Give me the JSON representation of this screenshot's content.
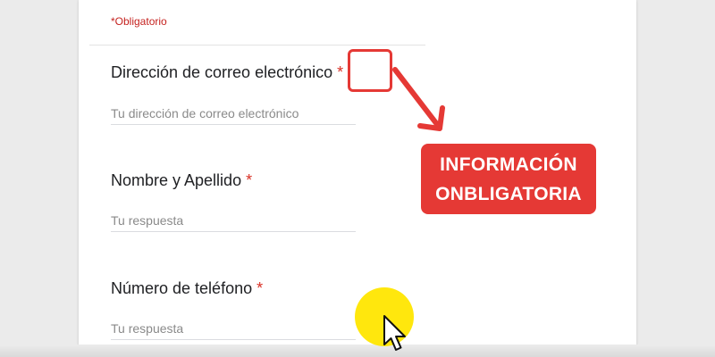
{
  "form": {
    "required_note": "*Obligatorio",
    "questions": [
      {
        "label": "Dirección de correo electrónico",
        "required_mark": "*",
        "placeholder": "Tu dirección de correo electrónico"
      },
      {
        "label": "Nombre y Apellido",
        "required_mark": "*",
        "placeholder": "Tu respuesta"
      },
      {
        "label": "Número de teléfono",
        "required_mark": "*",
        "placeholder": "Tu respuesta"
      }
    ]
  },
  "annotation": {
    "callout_line1": "INFORMACIÓN",
    "callout_line2": "ONBLIGATORIA",
    "accent_color": "#e53935"
  },
  "cursor": {
    "icon": "mouse-pointer-icon",
    "halo_color": "#ffe600"
  }
}
